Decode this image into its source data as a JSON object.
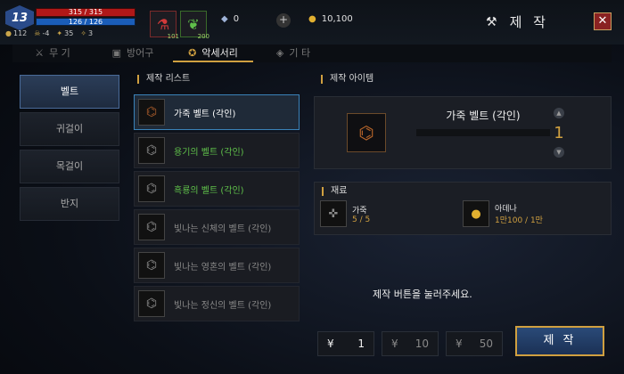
{
  "player": {
    "level": "13",
    "hp": "315 / 315",
    "mp": "126 / 126",
    "stats": [
      "112",
      "-4",
      "35",
      "3"
    ]
  },
  "inventory_slots": [
    {
      "icon": "potion-icon",
      "count": "101"
    },
    {
      "icon": "herb-icon",
      "count": "200"
    }
  ],
  "currencies": [
    {
      "icon": "crystal-icon",
      "value": "0"
    },
    {
      "icon": "gold-coin-icon",
      "value": "10,100"
    }
  ],
  "title": "제 작",
  "tabs": [
    {
      "label": "무 기",
      "icon": "sword-icon",
      "active": false
    },
    {
      "label": "방어구",
      "icon": "armor-icon",
      "active": false
    },
    {
      "label": "악세서리",
      "icon": "accessory-icon",
      "active": true
    },
    {
      "label": "기 타",
      "icon": "misc-icon",
      "active": false
    }
  ],
  "categories": [
    {
      "label": "벨트",
      "active": true
    },
    {
      "label": "귀걸이",
      "active": false
    },
    {
      "label": "목걸이",
      "active": false
    },
    {
      "label": "반지",
      "active": false
    }
  ],
  "list_heading": "제작 리스트",
  "craft_list": [
    {
      "name": "가죽 벨트 (각인)",
      "state": "active"
    },
    {
      "name": "용기의 벨트 (각인)",
      "state": "green"
    },
    {
      "name": "흑룡의 벨트 (각인)",
      "state": "green"
    },
    {
      "name": "빛나는 신체의 벨트 (각인)",
      "state": "gray"
    },
    {
      "name": "빛나는 영혼의 벨트 (각인)",
      "state": "gray"
    },
    {
      "name": "빛나는 정신의 벨트 (각인)",
      "state": "gray"
    }
  ],
  "item_heading": "제작 아이템",
  "selected": {
    "name": "가죽 벨트 (각인)",
    "quantity": "1"
  },
  "materials_heading": "재료",
  "materials": [
    {
      "name": "가죽",
      "qty": "5 / 5",
      "icon": "leather-icon"
    },
    {
      "name": "아데나",
      "qty": "1만100 / 1만",
      "icon": "adena-icon"
    }
  ],
  "hint": "제작 버튼을 눌러주세요.",
  "quantity_buttons": [
    "1",
    "10",
    "50"
  ],
  "craft_button": "제 작"
}
